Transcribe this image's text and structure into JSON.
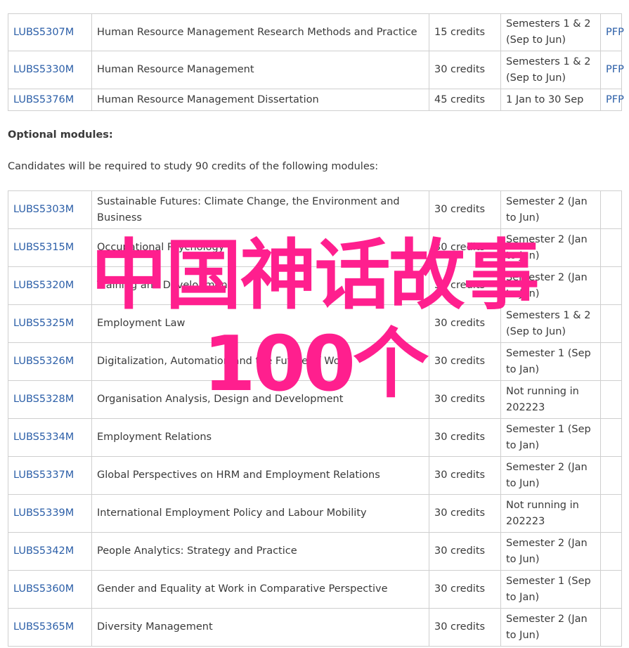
{
  "core_modules": [
    {
      "code": "LUBS5307M",
      "title": "Human Resource Management Research Methods and Practice",
      "credits": "15 credits",
      "semester": "Semesters 1 & 2 (Sep to Jun)",
      "link": "PFP"
    },
    {
      "code": "LUBS5330M",
      "title": "Human Resource Management",
      "credits": "30 credits",
      "semester": "Semesters 1 & 2 (Sep to Jun)",
      "link": "PFP"
    },
    {
      "code": "LUBS5376M",
      "title": "Human Resource Management Dissertation",
      "credits": "45 credits",
      "semester": "1 Jan to 30 Sep",
      "link": "PFP"
    }
  ],
  "optional": {
    "heading": "Optional modules:",
    "description": "Candidates will be required to study 90 credits of the following modules:",
    "modules": [
      {
        "code": "LUBS5303M",
        "title": "Sustainable Futures: Climate Change, the Environment and Business",
        "credits": "30 credits",
        "semester": "Semester 2 (Jan to Jun)"
      },
      {
        "code": "LUBS5315M",
        "title": "Occupational Psychology",
        "credits": "30 credits",
        "semester": "Semester 2 (Jan to Jun)"
      },
      {
        "code": "LUBS5320M",
        "title": "Training and Development",
        "credits": "30 credits",
        "semester": "Semester 2 (Jan to Jun)"
      },
      {
        "code": "LUBS5325M",
        "title": "Employment Law",
        "credits": "30 credits",
        "semester": "Semesters 1 & 2 (Sep to Jun)"
      },
      {
        "code": "LUBS5326M",
        "title": "Digitalization, Automation and the Future of Work",
        "credits": "30 credits",
        "semester": "Semester 1 (Sep to Jan)"
      },
      {
        "code": "LUBS5328M",
        "title": "Organisation Analysis, Design and Development",
        "credits": "30 credits",
        "semester": "Not running in 202223"
      },
      {
        "code": "LUBS5334M",
        "title": "Employment Relations",
        "credits": "30 credits",
        "semester": "Semester 1 (Sep to Jan)"
      },
      {
        "code": "LUBS5337M",
        "title": "Global Perspectives on HRM and Employment Relations",
        "credits": "30 credits",
        "semester": "Semester 2 (Jan to Jun)"
      },
      {
        "code": "LUBS5339M",
        "title": "International Employment Policy and Labour Mobility",
        "credits": "30 credits",
        "semester": "Not running in 202223"
      },
      {
        "code": "LUBS5342M",
        "title": "People Analytics: Strategy and Practice",
        "credits": "30 credits",
        "semester": "Semester 2 (Jan to Jun)"
      },
      {
        "code": "LUBS5360M",
        "title": "Gender and Equality at Work in Comparative Perspective",
        "credits": "30 credits",
        "semester": "Semester 1 (Sep to Jan)"
      },
      {
        "code": "LUBS5365M",
        "title": "Diversity Management",
        "credits": "30 credits",
        "semester": "Semester 2 (Jan to Jun)"
      }
    ]
  },
  "overlay": {
    "line1": "中国神话故事",
    "line2": "100个",
    "color": "#ff1f8e"
  },
  "colors": {
    "link": "#2c5fa8",
    "border": "#cfcfcf",
    "text": "#3a3a3a"
  }
}
